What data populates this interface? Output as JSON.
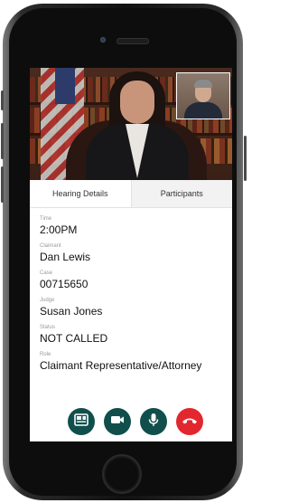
{
  "tabs": {
    "hearing_details": "Hearing Details",
    "participants": "Participants"
  },
  "details": {
    "time_label": "Time",
    "time_value": "2:00PM",
    "claimant_label": "Claimant",
    "claimant_value": "Dan Lewis",
    "case_label": "Case",
    "case_value": "00715650",
    "judge_label": "Judge",
    "judge_value": "Susan Jones",
    "status_label": "Status",
    "status_value": "NOT CALLED",
    "role_label": "Role",
    "role_value": "Claimant Representative/Attorney"
  },
  "controls": {
    "accent_color": "#114f4c",
    "end_color": "#e3272f",
    "icons": [
      "switch-view-icon",
      "video-camera-icon",
      "microphone-icon",
      "end-call-icon"
    ]
  }
}
